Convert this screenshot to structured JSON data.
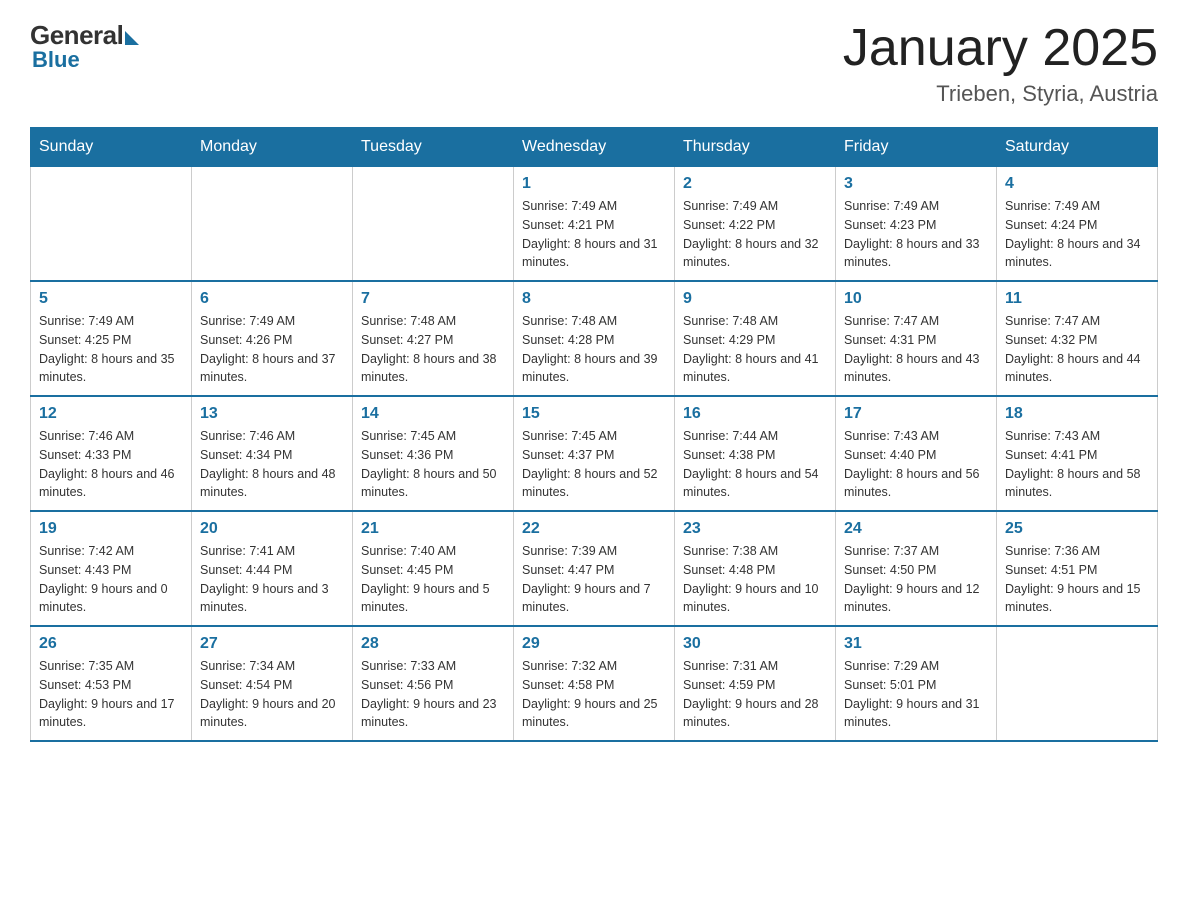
{
  "header": {
    "logo": {
      "general": "General",
      "blue": "Blue"
    },
    "title": "January 2025",
    "subtitle": "Trieben, Styria, Austria"
  },
  "days_of_week": [
    "Sunday",
    "Monday",
    "Tuesday",
    "Wednesday",
    "Thursday",
    "Friday",
    "Saturday"
  ],
  "weeks": [
    [
      {
        "day": "",
        "info": ""
      },
      {
        "day": "",
        "info": ""
      },
      {
        "day": "",
        "info": ""
      },
      {
        "day": "1",
        "info": "Sunrise: 7:49 AM\nSunset: 4:21 PM\nDaylight: 8 hours and 31 minutes."
      },
      {
        "day": "2",
        "info": "Sunrise: 7:49 AM\nSunset: 4:22 PM\nDaylight: 8 hours and 32 minutes."
      },
      {
        "day": "3",
        "info": "Sunrise: 7:49 AM\nSunset: 4:23 PM\nDaylight: 8 hours and 33 minutes."
      },
      {
        "day": "4",
        "info": "Sunrise: 7:49 AM\nSunset: 4:24 PM\nDaylight: 8 hours and 34 minutes."
      }
    ],
    [
      {
        "day": "5",
        "info": "Sunrise: 7:49 AM\nSunset: 4:25 PM\nDaylight: 8 hours and 35 minutes."
      },
      {
        "day": "6",
        "info": "Sunrise: 7:49 AM\nSunset: 4:26 PM\nDaylight: 8 hours and 37 minutes."
      },
      {
        "day": "7",
        "info": "Sunrise: 7:48 AM\nSunset: 4:27 PM\nDaylight: 8 hours and 38 minutes."
      },
      {
        "day": "8",
        "info": "Sunrise: 7:48 AM\nSunset: 4:28 PM\nDaylight: 8 hours and 39 minutes."
      },
      {
        "day": "9",
        "info": "Sunrise: 7:48 AM\nSunset: 4:29 PM\nDaylight: 8 hours and 41 minutes."
      },
      {
        "day": "10",
        "info": "Sunrise: 7:47 AM\nSunset: 4:31 PM\nDaylight: 8 hours and 43 minutes."
      },
      {
        "day": "11",
        "info": "Sunrise: 7:47 AM\nSunset: 4:32 PM\nDaylight: 8 hours and 44 minutes."
      }
    ],
    [
      {
        "day": "12",
        "info": "Sunrise: 7:46 AM\nSunset: 4:33 PM\nDaylight: 8 hours and 46 minutes."
      },
      {
        "day": "13",
        "info": "Sunrise: 7:46 AM\nSunset: 4:34 PM\nDaylight: 8 hours and 48 minutes."
      },
      {
        "day": "14",
        "info": "Sunrise: 7:45 AM\nSunset: 4:36 PM\nDaylight: 8 hours and 50 minutes."
      },
      {
        "day": "15",
        "info": "Sunrise: 7:45 AM\nSunset: 4:37 PM\nDaylight: 8 hours and 52 minutes."
      },
      {
        "day": "16",
        "info": "Sunrise: 7:44 AM\nSunset: 4:38 PM\nDaylight: 8 hours and 54 minutes."
      },
      {
        "day": "17",
        "info": "Sunrise: 7:43 AM\nSunset: 4:40 PM\nDaylight: 8 hours and 56 minutes."
      },
      {
        "day": "18",
        "info": "Sunrise: 7:43 AM\nSunset: 4:41 PM\nDaylight: 8 hours and 58 minutes."
      }
    ],
    [
      {
        "day": "19",
        "info": "Sunrise: 7:42 AM\nSunset: 4:43 PM\nDaylight: 9 hours and 0 minutes."
      },
      {
        "day": "20",
        "info": "Sunrise: 7:41 AM\nSunset: 4:44 PM\nDaylight: 9 hours and 3 minutes."
      },
      {
        "day": "21",
        "info": "Sunrise: 7:40 AM\nSunset: 4:45 PM\nDaylight: 9 hours and 5 minutes."
      },
      {
        "day": "22",
        "info": "Sunrise: 7:39 AM\nSunset: 4:47 PM\nDaylight: 9 hours and 7 minutes."
      },
      {
        "day": "23",
        "info": "Sunrise: 7:38 AM\nSunset: 4:48 PM\nDaylight: 9 hours and 10 minutes."
      },
      {
        "day": "24",
        "info": "Sunrise: 7:37 AM\nSunset: 4:50 PM\nDaylight: 9 hours and 12 minutes."
      },
      {
        "day": "25",
        "info": "Sunrise: 7:36 AM\nSunset: 4:51 PM\nDaylight: 9 hours and 15 minutes."
      }
    ],
    [
      {
        "day": "26",
        "info": "Sunrise: 7:35 AM\nSunset: 4:53 PM\nDaylight: 9 hours and 17 minutes."
      },
      {
        "day": "27",
        "info": "Sunrise: 7:34 AM\nSunset: 4:54 PM\nDaylight: 9 hours and 20 minutes."
      },
      {
        "day": "28",
        "info": "Sunrise: 7:33 AM\nSunset: 4:56 PM\nDaylight: 9 hours and 23 minutes."
      },
      {
        "day": "29",
        "info": "Sunrise: 7:32 AM\nSunset: 4:58 PM\nDaylight: 9 hours and 25 minutes."
      },
      {
        "day": "30",
        "info": "Sunrise: 7:31 AM\nSunset: 4:59 PM\nDaylight: 9 hours and 28 minutes."
      },
      {
        "day": "31",
        "info": "Sunrise: 7:29 AM\nSunset: 5:01 PM\nDaylight: 9 hours and 31 minutes."
      },
      {
        "day": "",
        "info": ""
      }
    ]
  ]
}
